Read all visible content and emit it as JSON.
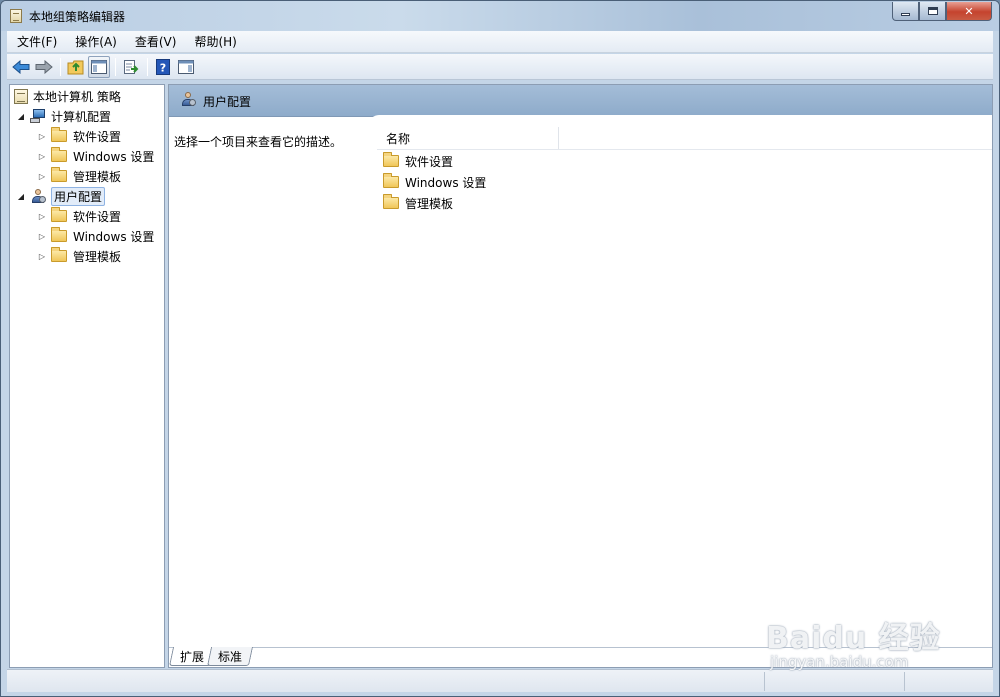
{
  "window": {
    "title": "本地组策略编辑器"
  },
  "menu": [
    "文件(F)",
    "操作(A)",
    "查看(V)",
    "帮助(H)"
  ],
  "toolbar": {
    "buttons": [
      "back-icon",
      "forward-icon",
      "up-folder-icon",
      "show-hide-tree-icon",
      "export-list-icon",
      "help-icon",
      "show-action-pane-icon"
    ]
  },
  "tree": {
    "root": "本地计算机 策略",
    "computer": {
      "label": "计算机配置",
      "children": [
        "软件设置",
        "Windows 设置",
        "管理模板"
      ]
    },
    "user": {
      "label": "用户配置",
      "children": [
        "软件设置",
        "Windows 设置",
        "管理模板"
      ]
    }
  },
  "details": {
    "header_title": "用户配置",
    "description": "选择一个项目来查看它的描述。",
    "column_name": "名称",
    "items": [
      "软件设置",
      "Windows 设置",
      "管理模板"
    ]
  },
  "tabs": [
    "扩展",
    "标准"
  ],
  "watermark": {
    "brand": "Baidu 经验",
    "url": "jingyan.baidu.com"
  },
  "colors": {
    "header_bar": "#9db6d2",
    "selection": "#e2ecf9",
    "close_button": "#c5432e"
  }
}
